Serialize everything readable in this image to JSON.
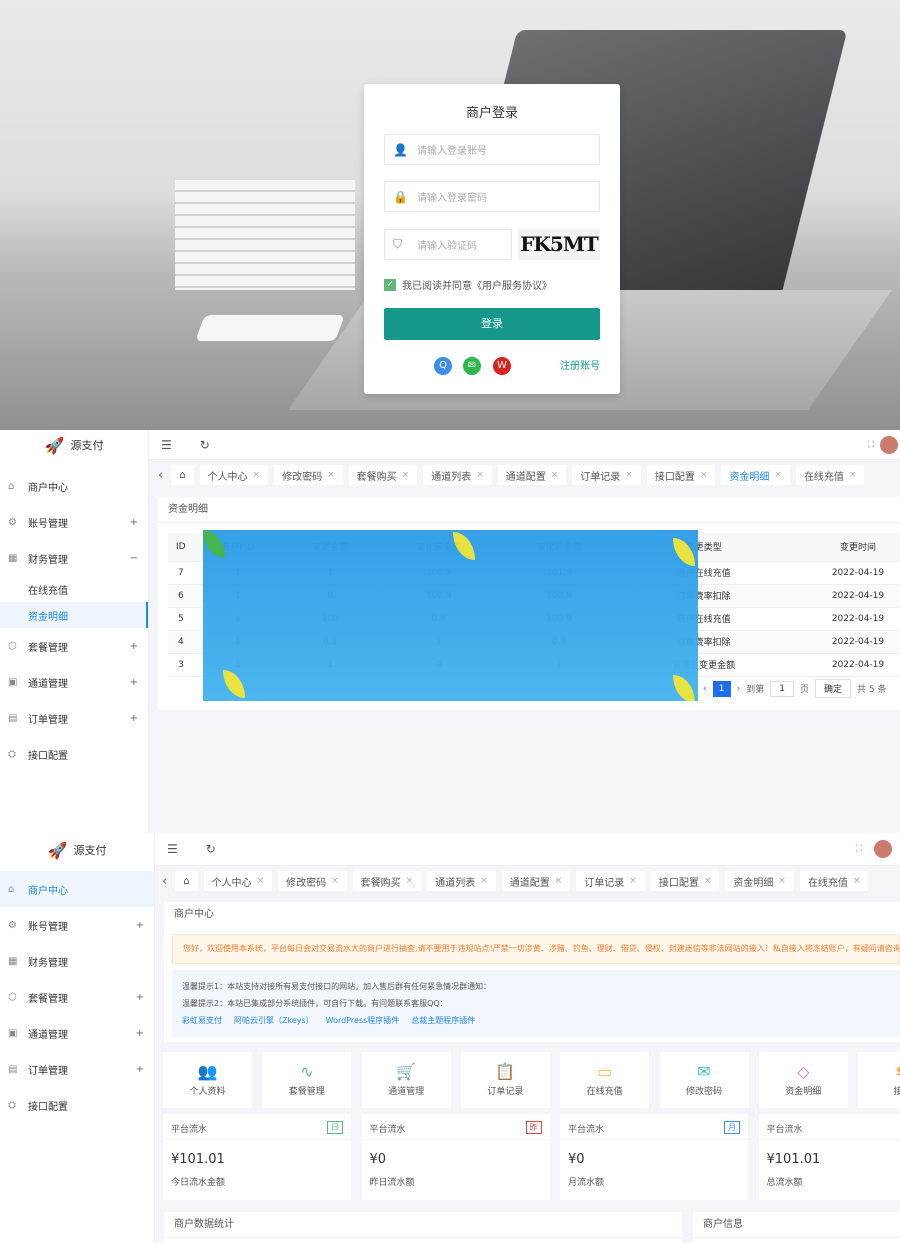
{
  "login": {
    "title": "商户登录",
    "account_placeholder": "请输入登录账号",
    "password_placeholder": "请输入登录密码",
    "captcha_placeholder": "请输入验证码",
    "captcha_text": "FK5MT",
    "agree": "我已阅读并同意《用户服务协议》",
    "submit": "登录",
    "register": "注册账号",
    "social": [
      "qq-icon",
      "wechat-icon",
      "weibo-icon"
    ]
  },
  "brand": "源支付",
  "sidebar": {
    "items": [
      {
        "label": "商户中心",
        "icon": "home-icon"
      },
      {
        "label": "账号管理",
        "icon": "gear-icon",
        "plus": "+"
      },
      {
        "label": "财务管理",
        "icon": "finance-icon",
        "plus": "−"
      },
      {
        "label": "在线充值"
      },
      {
        "label": "资金明细"
      },
      {
        "label": "套餐管理",
        "icon": "package-icon",
        "plus": "+"
      },
      {
        "label": "通道管理",
        "icon": "channel-icon",
        "plus": "+"
      },
      {
        "label": "订单管理",
        "icon": "order-icon",
        "plus": "+"
      },
      {
        "label": "接口配置",
        "icon": "api-icon"
      }
    ]
  },
  "tabs": [
    "个人中心",
    "修改密码",
    "套餐购买",
    "通道列表",
    "通道配置",
    "订单记录",
    "接口配置",
    "资金明细",
    "在线充值"
  ],
  "finance": {
    "title": "资金明细",
    "columns": [
      "ID",
      "商户PID",
      "变更金额",
      "变化前金额",
      "变化后金额",
      "变更类型",
      "变更时间"
    ],
    "rows": [
      [
        "7",
        "1",
        "1",
        "100.9",
        "101.9",
        "商户在线充值",
        "2022-04-19"
      ],
      [
        "6",
        "1",
        "0",
        "100.9",
        "100.9",
        "订单费率扣除",
        "2022-04-19"
      ],
      [
        "5",
        "1",
        "100",
        "0.9",
        "100.9",
        "商户在线充值",
        "2022-04-19"
      ],
      [
        "4",
        "1",
        "0.1",
        "1",
        "0.9",
        "订单费率扣除",
        "2022-04-19"
      ],
      [
        "3",
        "1",
        "1",
        "0",
        "1",
        "管理员变更金额",
        "2022-04-19"
      ]
    ],
    "pagination": {
      "current": "1",
      "goto": "到第",
      "page_value": "1",
      "page_unit": "页",
      "confirm": "确定",
      "total": "共 5 条"
    }
  },
  "dashboard": {
    "title": "商户中心",
    "notice": "您好，欢迎使用本系统，平台每日会对交易流水大的商户进行抽查,请不要用于违规站点!严禁一切涉黄、涉赌、钓鱼、理财、借贷、侵权、封建迷信等非法网站的接入！私自接入将冻结账户，有疑问请咨询客服",
    "tip1": "温馨提示1：本站支持对接所有易支付接口的网站，加入售后群有任何紧急情况群通知：",
    "tip2": "温馨提示2：本站已集成部分系统插件，可自行下载。有问题联系客服QQ：",
    "links": [
      "彩虹易支付",
      "阿帕云引擎（Zkeys）",
      "WordPress程序插件",
      "总裁主题程序插件"
    ],
    "shortcuts": [
      {
        "label": "个人资料",
        "icon": "users-icon",
        "color": "#3a8ee6"
      },
      {
        "label": "套餐管理",
        "icon": "pulse-icon",
        "color": "#5fb878"
      },
      {
        "label": "通道管理",
        "icon": "cart-icon",
        "color": "#f08a4b"
      },
      {
        "label": "订单记录",
        "icon": "clipboard-icon",
        "color": "#a78bd8"
      },
      {
        "label": "在线充值",
        "icon": "card-icon",
        "color": "#f5c04a"
      },
      {
        "label": "修改密码",
        "icon": "mail-icon",
        "color": "#3cc4c4"
      },
      {
        "label": "资金明细",
        "icon": "tag-icon",
        "color": "#e874a8"
      },
      {
        "label": "接口",
        "icon": "api-icon",
        "color": "#f0a040"
      }
    ],
    "stats": [
      {
        "title": "平台流水",
        "badge": "日",
        "badge_color": "#5fb878",
        "value": "¥101.01",
        "sub": "今日流水金额"
      },
      {
        "title": "平台流水",
        "badge": "昨",
        "badge_color": "#e0454a",
        "value": "¥0",
        "sub": "昨日流水额"
      },
      {
        "title": "平台流水",
        "badge": "月",
        "badge_color": "#3a8ee6",
        "value": "¥0",
        "sub": "月流水额"
      },
      {
        "title": "平台流水",
        "value": "¥101.01",
        "sub": "总流水额"
      }
    ],
    "bottom": [
      "商户数据统计",
      "商户信息"
    ]
  },
  "colors": {
    "accent": "#16998a",
    "link": "#1e88e5"
  }
}
